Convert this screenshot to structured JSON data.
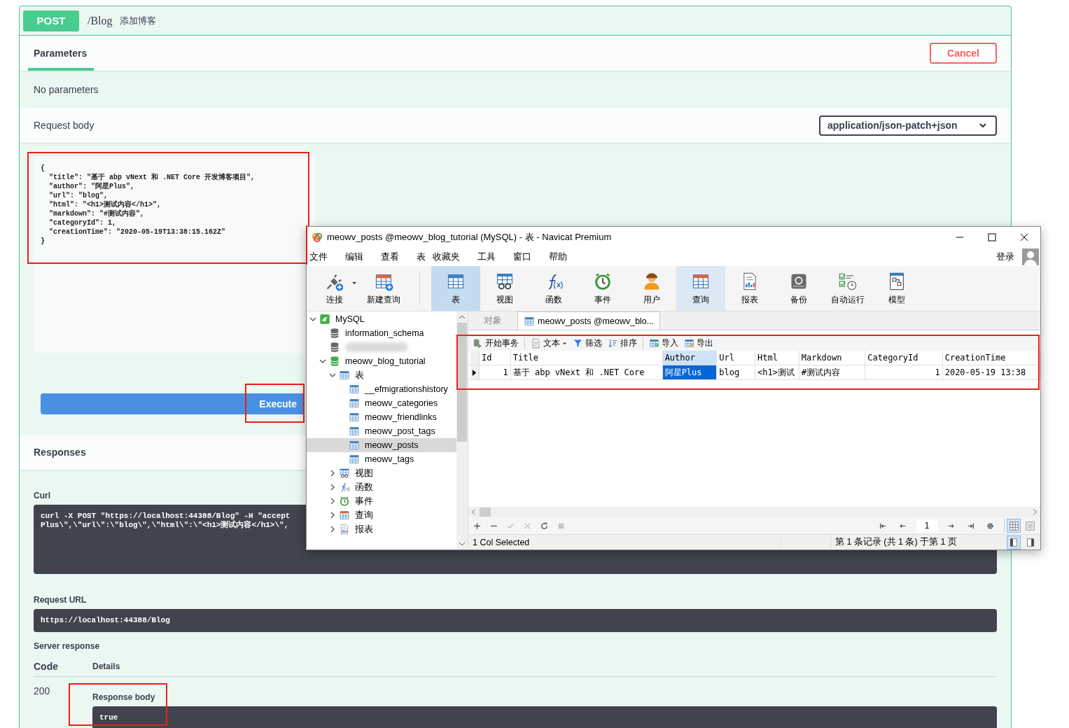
{
  "operation": {
    "method": "POST",
    "path": "/Blog",
    "summary": "添加博客"
  },
  "tabs": [
    {
      "label": "Parameters",
      "selected": true
    }
  ],
  "cancel_button": "Cancel",
  "parameters_note": "No parameters",
  "request_body": {
    "label": "Request body",
    "content_type": "application/json-patch+json",
    "lines": [
      "{",
      "  \"title\": \"基于 abp vNext 和 .NET Core 开发博客项目\",",
      "  \"author\": \"阿星Plus\",",
      "  \"url\": \"blog\",",
      "  \"html\": \"<h1>测试内容</h1>\",",
      "  \"markdown\": \"#测试内容\",",
      "  \"categoryId\": 1,",
      "  \"creationTime\": \"2020-05-19T13:38:15.162Z\"",
      "}"
    ]
  },
  "execute_button": "Execute",
  "responses": {
    "title": "Responses",
    "curl_label": "Curl",
    "curl_lines": [
      "curl -X POST \"https://localhost:44388/Blog\" -H \"accept",
      "Plus\\\",\\\"url\\\":\\\"blog\\\",\\\"html\\\":\\\"<h1>测试内容</h1>\\\","
    ],
    "request_url_label": "Request URL",
    "request_url": "https://localhost:44388/Blog",
    "server_response_label": "Server response",
    "columns": [
      "Code",
      "Details"
    ],
    "code": "200",
    "response_body_label": "Response body",
    "response_body": "true"
  },
  "navicat": {
    "title": "meowv_posts @meowv_blog_tutorial (MySQL) - 表 - Navicat Premium",
    "menu": [
      "文件",
      "编辑",
      "查看",
      "表",
      "收藏夹",
      "工具",
      "窗口",
      "帮助"
    ],
    "login": "登录",
    "toolbar": [
      {
        "label": "连接",
        "kind": "connect",
        "dropdown": true,
        "selected": false,
        "hovered": false
      },
      {
        "label": "新建查询",
        "kind": "new-query",
        "selected": false,
        "hovered": false
      },
      {
        "label": "表",
        "kind": "table",
        "selected": true,
        "hovered": false
      },
      {
        "label": "视图",
        "kind": "view",
        "selected": false,
        "hovered": false
      },
      {
        "label": "函数",
        "kind": "function",
        "selected": false,
        "hovered": false
      },
      {
        "label": "事件",
        "kind": "event",
        "selected": false,
        "hovered": false
      },
      {
        "label": "用户",
        "kind": "user",
        "selected": false,
        "hovered": false
      },
      {
        "label": "查询",
        "kind": "query",
        "selected": false,
        "hovered": true
      },
      {
        "label": "报表",
        "kind": "report",
        "selected": false,
        "hovered": false
      },
      {
        "label": "备份",
        "kind": "backup",
        "selected": false,
        "hovered": false
      },
      {
        "label": "自动运行",
        "kind": "schedule",
        "selected": false,
        "hovered": false
      },
      {
        "label": "模型",
        "kind": "model",
        "selected": false,
        "hovered": false
      }
    ],
    "tree": [
      {
        "label": "MySQL",
        "kind": "server",
        "expanded": true,
        "selected": false,
        "children": [
          {
            "label": "information_schema",
            "kind": "database",
            "selected": false
          },
          {
            "kind": "database",
            "blurred": true,
            "selected": false
          },
          {
            "label": "meowv_blog_tutorial",
            "kind": "database",
            "expanded": true,
            "selected": false,
            "children": [
              {
                "label": "表",
                "kind": "table",
                "expanded": true,
                "selected": false,
                "children": [
                  {
                    "label": "__efmigrationshistory",
                    "kind": "table",
                    "selected": false
                  },
                  {
                    "label": "meowv_categories",
                    "kind": "table",
                    "selected": false
                  },
                  {
                    "label": "meowv_friendlinks",
                    "kind": "table",
                    "selected": false
                  },
                  {
                    "label": "meowv_post_tags",
                    "kind": "table",
                    "selected": false
                  },
                  {
                    "label": "meowv_posts",
                    "kind": "table",
                    "selected": true
                  },
                  {
                    "label": "meowv_tags",
                    "kind": "table",
                    "selected": false
                  }
                ]
              },
              {
                "label": "视图",
                "kind": "view",
                "expanded": false,
                "selected": false
              },
              {
                "label": "函数",
                "kind": "function",
                "expanded": false,
                "selected": false
              },
              {
                "label": "事件",
                "kind": "event",
                "expanded": false,
                "selected": false
              },
              {
                "label": "查询",
                "kind": "query",
                "expanded": false,
                "selected": false
              },
              {
                "label": "报表",
                "kind": "report",
                "expanded": false,
                "selected": false
              }
            ]
          }
        ]
      }
    ],
    "tabs": [
      {
        "label": "对象",
        "selected": false
      },
      {
        "label": "meowv_posts @meowv_blo...",
        "selected": true
      }
    ],
    "grid_toolbar": [
      {
        "label": "开始事务",
        "kind": "transaction"
      },
      {
        "label": "文本",
        "kind": "text",
        "dropdown": true
      },
      {
        "label": "筛选",
        "kind": "filter"
      },
      {
        "label": "排序",
        "kind": "sort"
      },
      {
        "label": "导入",
        "kind": "import"
      },
      {
        "label": "导出",
        "kind": "export"
      }
    ],
    "columns": [
      {
        "name": "Id",
        "kind": "number",
        "selected": false
      },
      {
        "name": "Title",
        "kind": "text",
        "selected": false
      },
      {
        "name": "Author",
        "kind": "text",
        "selected": true
      },
      {
        "name": "Url",
        "kind": "text",
        "selected": false
      },
      {
        "name": "Html",
        "kind": "text",
        "selected": false
      },
      {
        "name": "Markdown",
        "kind": "text",
        "selected": false
      },
      {
        "name": "CategoryId",
        "kind": "number",
        "selected": false
      },
      {
        "name": "CreationTime",
        "kind": "text",
        "selected": false
      }
    ],
    "rows": [
      {
        "current": true,
        "cells": [
          "1",
          "基于 abp vNext 和 .NET Core",
          "阿星Plus",
          "blog",
          "<h1>测试",
          "#测试内容",
          "1",
          "2020-05-19 13:38"
        ]
      }
    ],
    "edit_buttons": [
      {
        "kind": "add",
        "disabled": false
      },
      {
        "kind": "remove",
        "disabled": false
      },
      {
        "kind": "confirm",
        "disabled": true
      },
      {
        "kind": "cancel",
        "disabled": true
      },
      {
        "kind": "refresh",
        "disabled": false
      },
      {
        "kind": "stop",
        "disabled": true
      }
    ],
    "page": "1",
    "view_modes": [
      {
        "kind": "grid-view",
        "selected": true
      },
      {
        "kind": "form-view",
        "selected": false
      }
    ],
    "status": "1 Col Selected",
    "record_info": "第 1 条记录 (共 1 条) 于第 1 页",
    "panel_modes": [
      {
        "kind": "panel-left",
        "selected": true
      },
      {
        "kind": "panel-right",
        "selected": false
      }
    ]
  }
}
